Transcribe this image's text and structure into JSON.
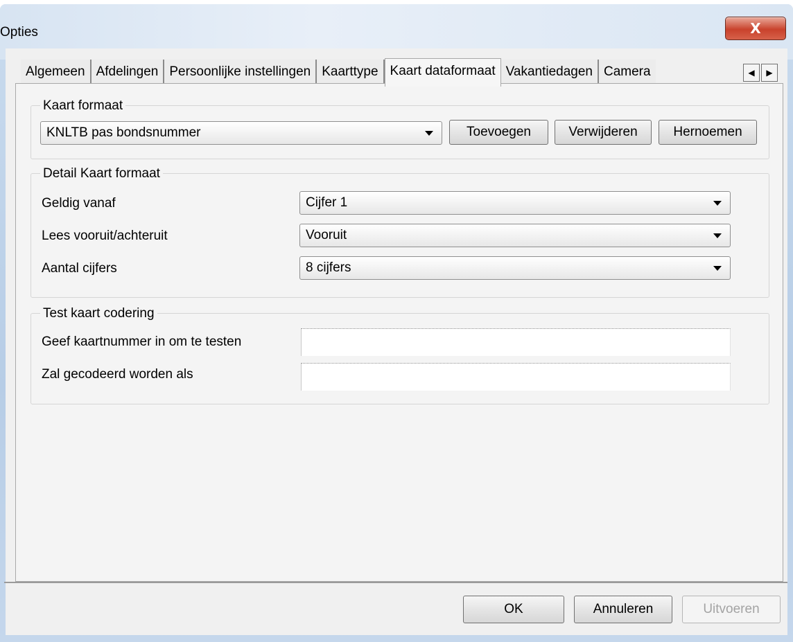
{
  "window": {
    "title": "Opties",
    "close_glyph": "X"
  },
  "tabs": [
    {
      "label": "Algemeen"
    },
    {
      "label": "Afdelingen"
    },
    {
      "label": "Persoonlijke instellingen"
    },
    {
      "label": "Kaarttype"
    },
    {
      "label": "Kaart dataformaat",
      "active": true
    },
    {
      "label": "Vakantiedagen"
    },
    {
      "label": "Camera"
    }
  ],
  "tab_scroll": {
    "left_glyph": "◀",
    "right_glyph": "▶"
  },
  "kaart_formaat": {
    "title": "Kaart formaat",
    "selected": "KNLTB pas bondsnummer",
    "add_label": "Toevoegen",
    "delete_label": "Verwijderen",
    "rename_label": "Hernoemen"
  },
  "detail": {
    "title": "Detail Kaart formaat",
    "rows": [
      {
        "label": "Geldig vanaf",
        "value": "Cijfer 1"
      },
      {
        "label": "Lees vooruit/achteruit",
        "value": "Vooruit"
      },
      {
        "label": "Aantal cijfers",
        "value": "8 cijfers"
      }
    ]
  },
  "test": {
    "title": "Test kaart codering",
    "input_label": "Geef kaartnummer in om te testen",
    "input_value": "",
    "output_label": "Zal gecodeerd worden als",
    "output_value": ""
  },
  "footer": {
    "ok_label": "OK",
    "cancel_label": "Annuleren",
    "apply_label": "Uitvoeren"
  }
}
